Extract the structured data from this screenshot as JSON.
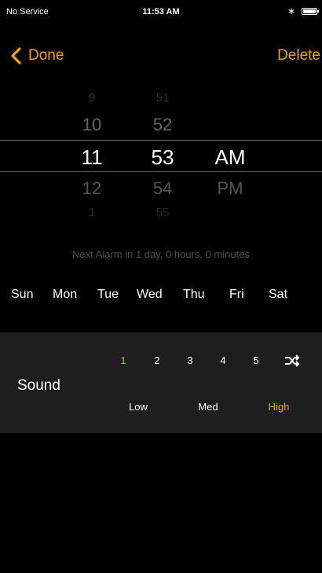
{
  "status_bar": {
    "carrier": "No Service",
    "time": "11:53 AM",
    "bluetooth_icon": "bluetooth-icon",
    "battery_icon": "battery-icon"
  },
  "nav": {
    "done_label": "Done",
    "delete_label": "Delete"
  },
  "picker": {
    "hours": [
      "9",
      "10",
      "11",
      "12",
      "1"
    ],
    "minutes": [
      "51",
      "52",
      "53",
      "54",
      "55"
    ],
    "ampm": [
      "AM",
      "PM"
    ],
    "selected": {
      "hour": "11",
      "minute": "53",
      "ampm": "AM"
    }
  },
  "next_alarm": "Next Alarm in 1 day, 0 hours, 0 minutes",
  "days": [
    "Sun",
    "Mon",
    "Tue",
    "Wed",
    "Thu",
    "Fri",
    "Sat"
  ],
  "sound": {
    "label": "Sound",
    "levels": [
      "1",
      "2",
      "3",
      "4",
      "5"
    ],
    "selected_level": "1",
    "shuffle_icon": "shuffle-icon",
    "volumes": [
      "Low",
      "Med",
      "High"
    ],
    "selected_volume": "High"
  },
  "colors": {
    "accent": "#f0a11f",
    "background": "#000000",
    "panel": "#1e1e1e"
  }
}
